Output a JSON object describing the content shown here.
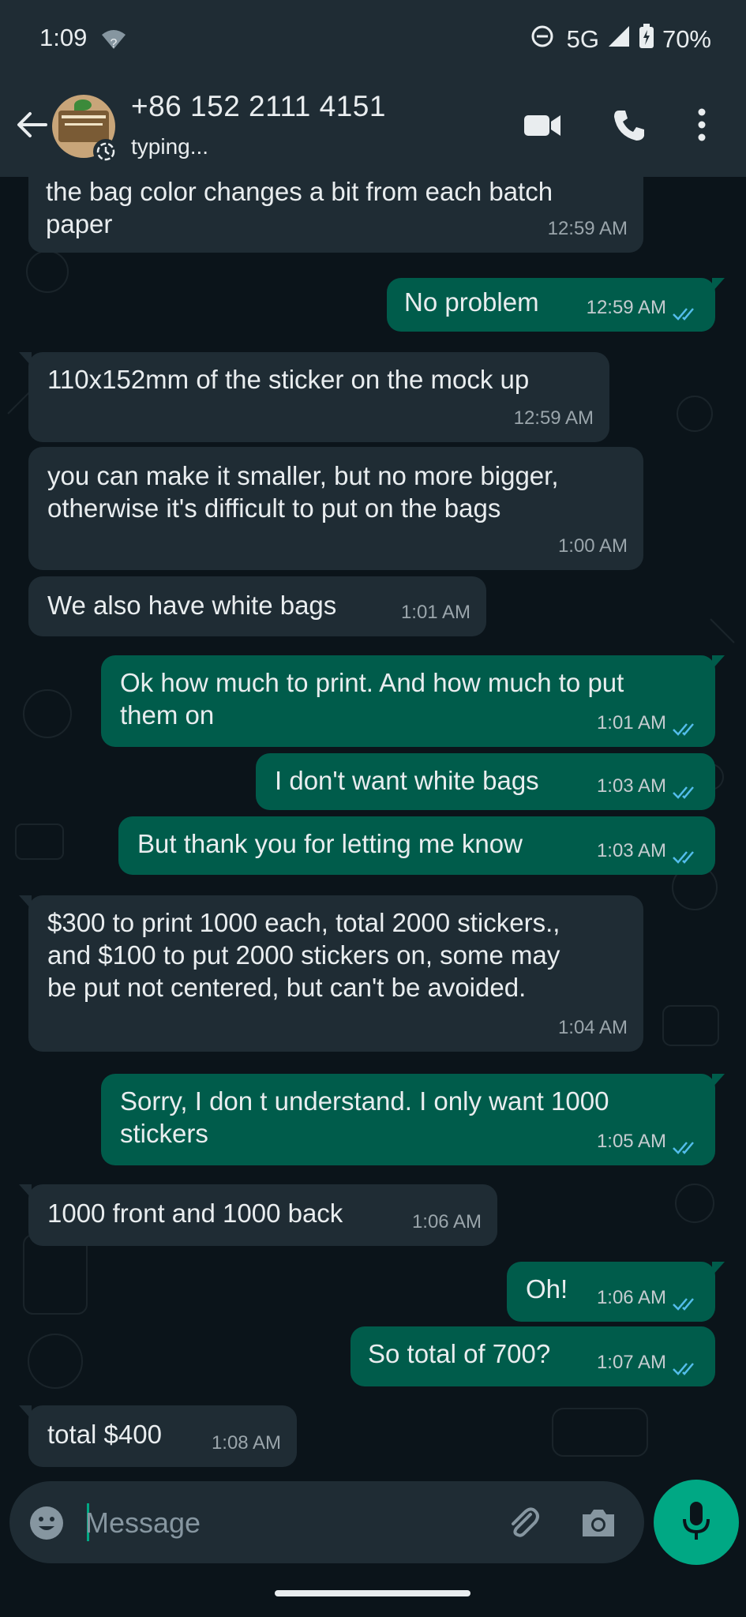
{
  "status_bar": {
    "time": "1:09",
    "wifi_badge": "?",
    "network": "5G",
    "battery": "70%"
  },
  "header": {
    "contact": "+86 152 2111 4151",
    "status": "typing..."
  },
  "messages": [
    {
      "dir": "in",
      "text": "the bag color changes a bit from each batch\npaper",
      "time": "12:59 AM"
    },
    {
      "dir": "out",
      "text": "No problem",
      "time": "12:59 AM"
    },
    {
      "dir": "in",
      "text": "110x152mm of the sticker on the mock up",
      "time": "12:59 AM"
    },
    {
      "dir": "in",
      "text": "you can make it smaller, but no more bigger,\notherwise it's difficult to put on the bags",
      "time": "1:00 AM"
    },
    {
      "dir": "in",
      "text": "We also have white bags",
      "time": "1:01 AM"
    },
    {
      "dir": "out",
      "text": "Ok how much to print.  And how much to put\nthem on",
      "time": "1:01 AM"
    },
    {
      "dir": "out",
      "text": "I don't want white bags",
      "time": "1:03 AM"
    },
    {
      "dir": "out",
      "text": "But thank you for letting me know",
      "time": "1:03 AM"
    },
    {
      "dir": "in",
      "text": "$300 to print 1000 each, total 2000 stickers.,\nand $100 to put 2000 stickers on, some may\nbe put not centered, but can't be avoided.",
      "time": "1:04 AM"
    },
    {
      "dir": "out",
      "text": "Sorry, I don t understand.  I only want 1000\nstickers",
      "time": "1:05 AM"
    },
    {
      "dir": "in",
      "text": "1000 front and 1000 back",
      "time": "1:06 AM"
    },
    {
      "dir": "out",
      "text": "Oh!",
      "time": "1:06 AM"
    },
    {
      "dir": "out",
      "text": "So total of 700?",
      "time": "1:07 AM"
    },
    {
      "dir": "in",
      "text": "total $400",
      "time": "1:08 AM"
    }
  ],
  "composer": {
    "placeholder": "Message"
  },
  "colors": {
    "background": "#0b141a",
    "incoming_bubble": "#1f2c34",
    "outgoing_bubble": "#005c4b",
    "accent": "#00a884",
    "read_tick": "#53bdeb"
  }
}
